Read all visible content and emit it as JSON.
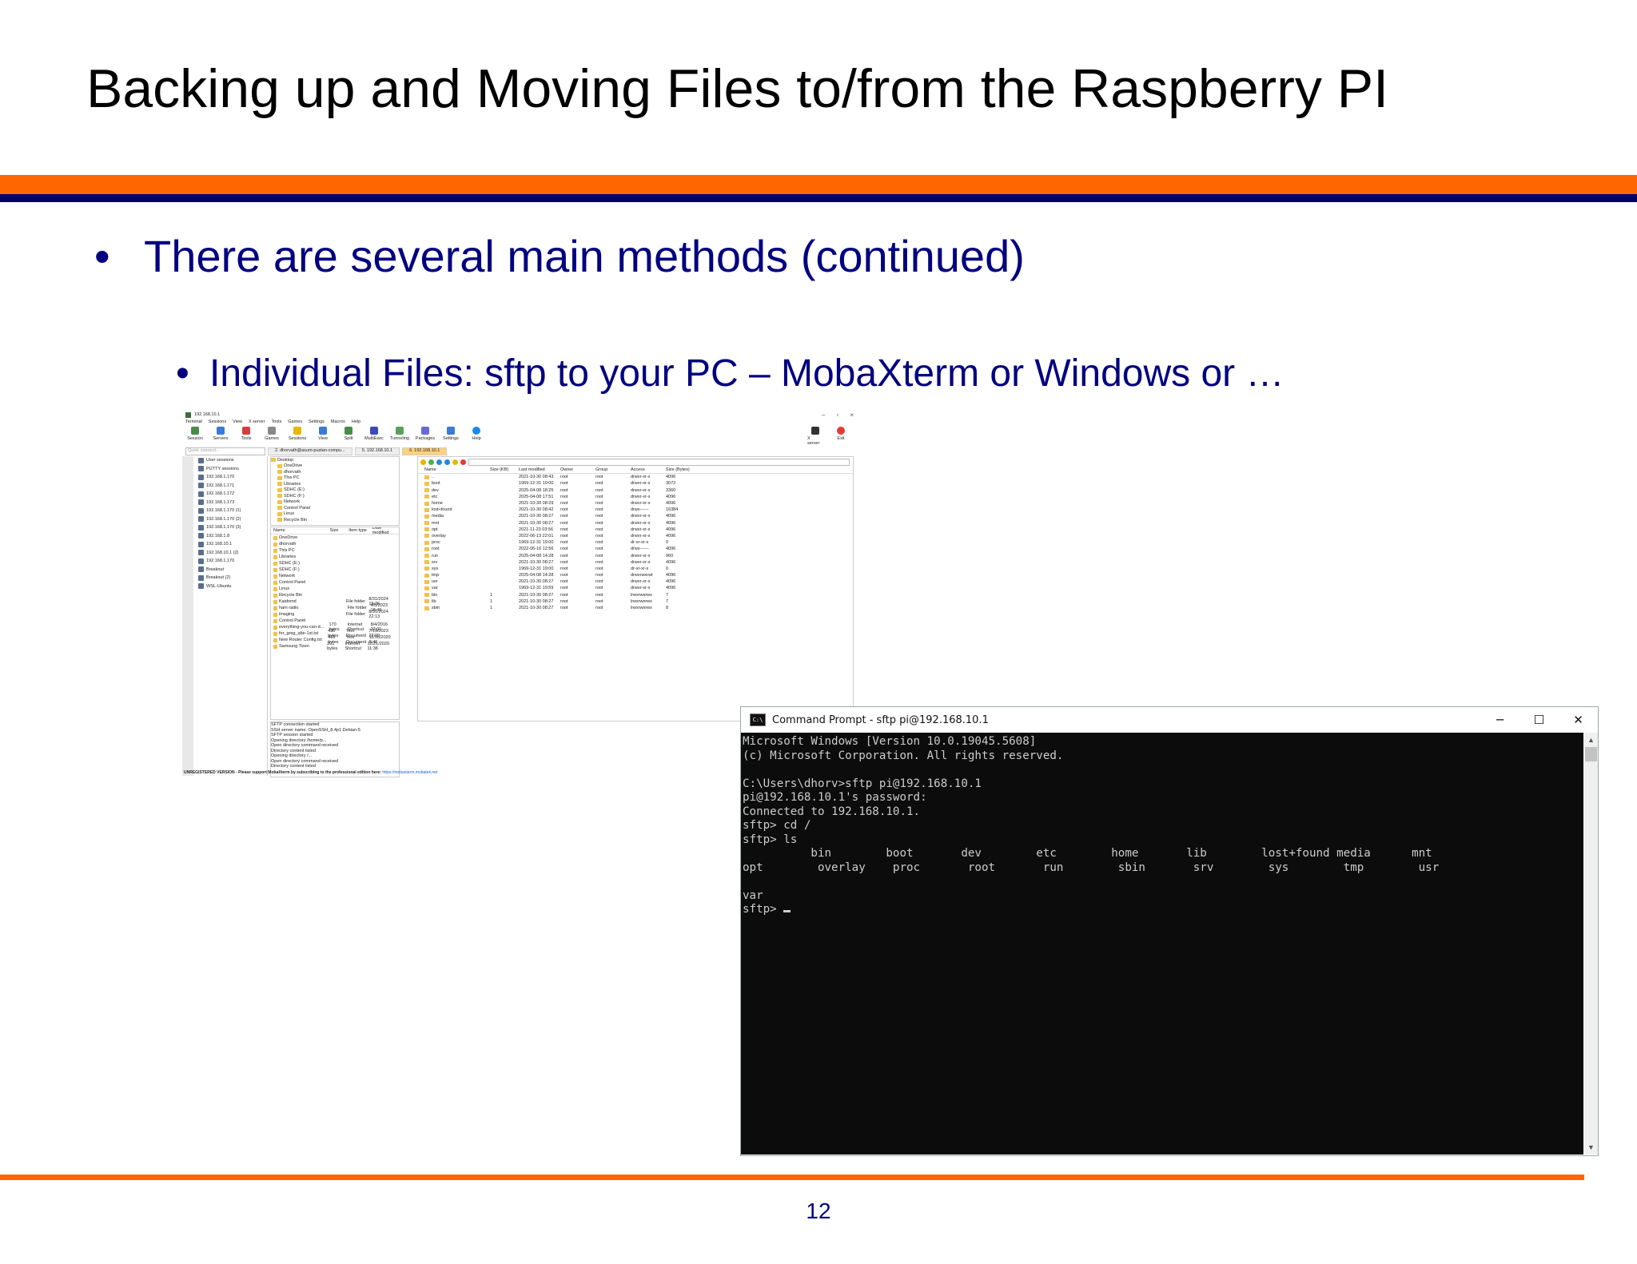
{
  "slide": {
    "title": "Backing up and Moving Files to/from the Raspberry PI",
    "bullet1": "There are several main methods (continued)",
    "bullet2": "Individual Files: sftp to your PC – MobaXterm or Windows or …",
    "bullet_glyph": "•",
    "page_number": "12",
    "colors": {
      "orange": "#ff6600",
      "navy": "#000066",
      "text": "#000080"
    }
  },
  "mobaxterm": {
    "title": "192.168.10.1",
    "window_controls": [
      "–",
      "▫",
      "×"
    ],
    "menu": [
      "Terminal",
      "Sessions",
      "View",
      "X server",
      "Tools",
      "Games",
      "Settings",
      "Macros",
      "Help"
    ],
    "toolbar": [
      "Session",
      "Servers",
      "Tools",
      "Games",
      "Sessions",
      "View",
      "Split",
      "MultiExec",
      "Tunneling",
      "Packages",
      "Settings",
      "Help"
    ],
    "toolbar_right": [
      "X server",
      "Exit"
    ],
    "quick_connect_placeholder": "Quick connect...",
    "tabs": [
      "2. dhorvath@asum-pustan-compu...",
      "5. 192.168.10.1",
      "6. 192.168.10.1"
    ],
    "sessions": [
      "User sessions",
      "PUTTY sessions",
      "192.168.1.170",
      "192.168.1.171",
      "192.168.1.172",
      "192.168.1.173",
      "192.168.1.170 (1)",
      "192.168.1.170 (2)",
      "192.168.1.170 (3)",
      "192.168.1.8",
      "192.168.10.1",
      "192.168.10.1 (2)",
      "192.168.1.170",
      "Breakout",
      "Breakout (2)",
      "WSL-Ubuntu"
    ],
    "local_tree": [
      "Desktop",
      "OneDrive",
      "dhorvath",
      "This PC",
      "Libraries",
      "SDHC (E:)",
      "SDHC (F:)",
      "Network",
      "Control Panel",
      "Linux",
      "Recycle Bin"
    ],
    "local_list_headers": [
      "Name",
      "Size",
      "Item type",
      "Date modified"
    ],
    "local_list": [
      {
        "name": "OneDrive",
        "size": "",
        "type": "",
        "date": ""
      },
      {
        "name": "dhorvath",
        "size": "",
        "type": "",
        "date": ""
      },
      {
        "name": "This PC",
        "size": "",
        "type": "",
        "date": ""
      },
      {
        "name": "Libraries",
        "size": "",
        "type": "",
        "date": ""
      },
      {
        "name": "SDHC (E:)",
        "size": "",
        "type": "",
        "date": ""
      },
      {
        "name": "SDHC (F:)",
        "size": "",
        "type": "",
        "date": ""
      },
      {
        "name": "Network",
        "size": "",
        "type": "",
        "date": ""
      },
      {
        "name": "Control Panel",
        "size": "",
        "type": "",
        "date": ""
      },
      {
        "name": "Linux",
        "size": "",
        "type": "",
        "date": ""
      },
      {
        "name": "Recycle Bin",
        "size": "",
        "type": "",
        "date": ""
      },
      {
        "name": "Kaidomd",
        "size": "",
        "type": "File folder",
        "date": "8/31/2024 19:36"
      },
      {
        "name": "ham radio",
        "size": "",
        "type": "File folder",
        "date": "4/5/2023 18:49"
      },
      {
        "name": "imaging",
        "size": "",
        "type": "File folder",
        "date": "8/31/2024 22:13"
      },
      {
        "name": "Control Panel",
        "size": "",
        "type": "",
        "date": ""
      },
      {
        "name": "everything-you-can-d...",
        "size": "170 bytes",
        "type": "Internet Shortcut",
        "date": "8/4/2016 22:01"
      },
      {
        "name": "for_greg_abe-1st.txt",
        "size": "436 bytes",
        "type": "Text Document",
        "date": "7/19/2023 23:09"
      },
      {
        "name": "New Router Config.txt",
        "size": "456 bytes",
        "type": "Text Document",
        "date": "11/16/2020 8:46"
      },
      {
        "name": "Samsung Tizen",
        "size": "201 bytes",
        "type": "Internet Shortcut",
        "date": "12/21/2020 11:38"
      }
    ],
    "log": [
      "SFTP connection started",
      "SSH server name: OpenSSH_8.4p1 Debian-5",
      "SFTP session started",
      "Opening directory /home/p...",
      "Open directory command received",
      "Directory content listed",
      "Opening directory /...",
      "Open directory command received",
      "Directory content listed"
    ],
    "remote_headers": [
      "Name",
      "Size (KB)",
      "Last modified",
      "Owner",
      "Group",
      "Access",
      "Size (Bytes)"
    ],
    "remote_files": [
      {
        "name": "..",
        "size": "",
        "mod": "2021-10-30 08:43",
        "own": "root",
        "grp": "root",
        "acc": "drwxr-xr-x",
        "sz": "4096"
      },
      {
        "name": "boot",
        "size": "",
        "mod": "1969-12-31 19:00",
        "own": "root",
        "grp": "root",
        "acc": "drwxr-xr-x",
        "sz": "3072"
      },
      {
        "name": "dev",
        "size": "",
        "mod": "2025-04-08 18:25",
        "own": "root",
        "grp": "root",
        "acc": "drwxr-xr-x",
        "sz": "3360"
      },
      {
        "name": "etc",
        "size": "",
        "mod": "2025-04-08 17:51",
        "own": "root",
        "grp": "root",
        "acc": "drwxr-xr-x",
        "sz": "4096"
      },
      {
        "name": "home",
        "size": "",
        "mod": "2021-10-30 08:29",
        "own": "root",
        "grp": "root",
        "acc": "drwxr-xr-x",
        "sz": "4096"
      },
      {
        "name": "lost+found",
        "size": "",
        "mod": "2021-10-30 08:42",
        "own": "root",
        "grp": "root",
        "acc": "drwx------",
        "sz": "16384"
      },
      {
        "name": "media",
        "size": "",
        "mod": "2021-10-30 08:27",
        "own": "root",
        "grp": "root",
        "acc": "drwxr-xr-x",
        "sz": "4096"
      },
      {
        "name": "mnt",
        "size": "",
        "mod": "2021-10-30 08:27",
        "own": "root",
        "grp": "root",
        "acc": "drwxr-xr-x",
        "sz": "4096"
      },
      {
        "name": "opt",
        "size": "",
        "mod": "2021-11-23 03:56",
        "own": "root",
        "grp": "root",
        "acc": "drwxr-xr-x",
        "sz": "4096"
      },
      {
        "name": "overlay",
        "size": "",
        "mod": "2022-06-13 22:01",
        "own": "root",
        "grp": "root",
        "acc": "drwxr-xr-x",
        "sz": "4096"
      },
      {
        "name": "proc",
        "size": "",
        "mod": "1969-12-31 19:00",
        "own": "root",
        "grp": "root",
        "acc": "dr-xr-xr-x",
        "sz": "0"
      },
      {
        "name": "root",
        "size": "",
        "mod": "2022-06-16 12:56",
        "own": "root",
        "grp": "root",
        "acc": "drwx------",
        "sz": "4096"
      },
      {
        "name": "run",
        "size": "",
        "mod": "2025-04-08 14:28",
        "own": "root",
        "grp": "root",
        "acc": "drwxr-xr-x",
        "sz": "960"
      },
      {
        "name": "srv",
        "size": "",
        "mod": "2021-10-30 08:27",
        "own": "root",
        "grp": "root",
        "acc": "drwxr-xr-x",
        "sz": "4096"
      },
      {
        "name": "sys",
        "size": "",
        "mod": "1969-12-31 19:00",
        "own": "root",
        "grp": "root",
        "acc": "dr-xr-xr-x",
        "sz": "0"
      },
      {
        "name": "tmp",
        "size": "",
        "mod": "2025-04-08 14:28",
        "own": "root",
        "grp": "root",
        "acc": "drwxrwxrwt",
        "sz": "4096"
      },
      {
        "name": "usr",
        "size": "",
        "mod": "2021-10-30 08:27",
        "own": "root",
        "grp": "root",
        "acc": "drwxr-xr-x",
        "sz": "4096"
      },
      {
        "name": "var",
        "size": "",
        "mod": "1969-12-31 19:59",
        "own": "root",
        "grp": "root",
        "acc": "drwxr-xr-x",
        "sz": "4096"
      },
      {
        "name": "bin",
        "size": "1",
        "mod": "2021-10-30 08:27",
        "own": "root",
        "grp": "root",
        "acc": "lrwxrwxrwx",
        "sz": "7"
      },
      {
        "name": "lib",
        "size": "1",
        "mod": "2021-10-30 08:27",
        "own": "root",
        "grp": "root",
        "acc": "lrwxrwxrwx",
        "sz": "7"
      },
      {
        "name": "sbin",
        "size": "1",
        "mod": "2021-10-30 08:27",
        "own": "root",
        "grp": "root",
        "acc": "lrwxrwxrwx",
        "sz": "8"
      }
    ],
    "status_text": "UNREGISTERED VERSION  -  Please support MobaXterm by subscribing to the professional edition here: ",
    "status_link": "https://mobaxterm.mobatek.net"
  },
  "cmd": {
    "title": "Command Prompt - sftp  pi@192.168.10.1",
    "icon_text": "C:\\",
    "controls": [
      "─",
      "☐",
      "✕"
    ],
    "lines": [
      "Microsoft Windows [Version 10.0.19045.5608]",
      "(c) Microsoft Corporation. All rights reserved.",
      "",
      "C:\\Users\\dhorv>sftp pi@192.168.10.1",
      "pi@192.168.10.1's password:",
      "Connected to 192.168.10.1.",
      "sftp> cd /",
      "sftp> ls",
      "          bin        boot       dev        etc        home       lib        lost+found media      mnt",
      "opt        overlay    proc       root       run        sbin       srv        sys        tmp        usr",
      "",
      "var",
      "sftp> "
    ],
    "colors": {
      "background": "#0c0c0c",
      "text": "#cccccc"
    }
  }
}
